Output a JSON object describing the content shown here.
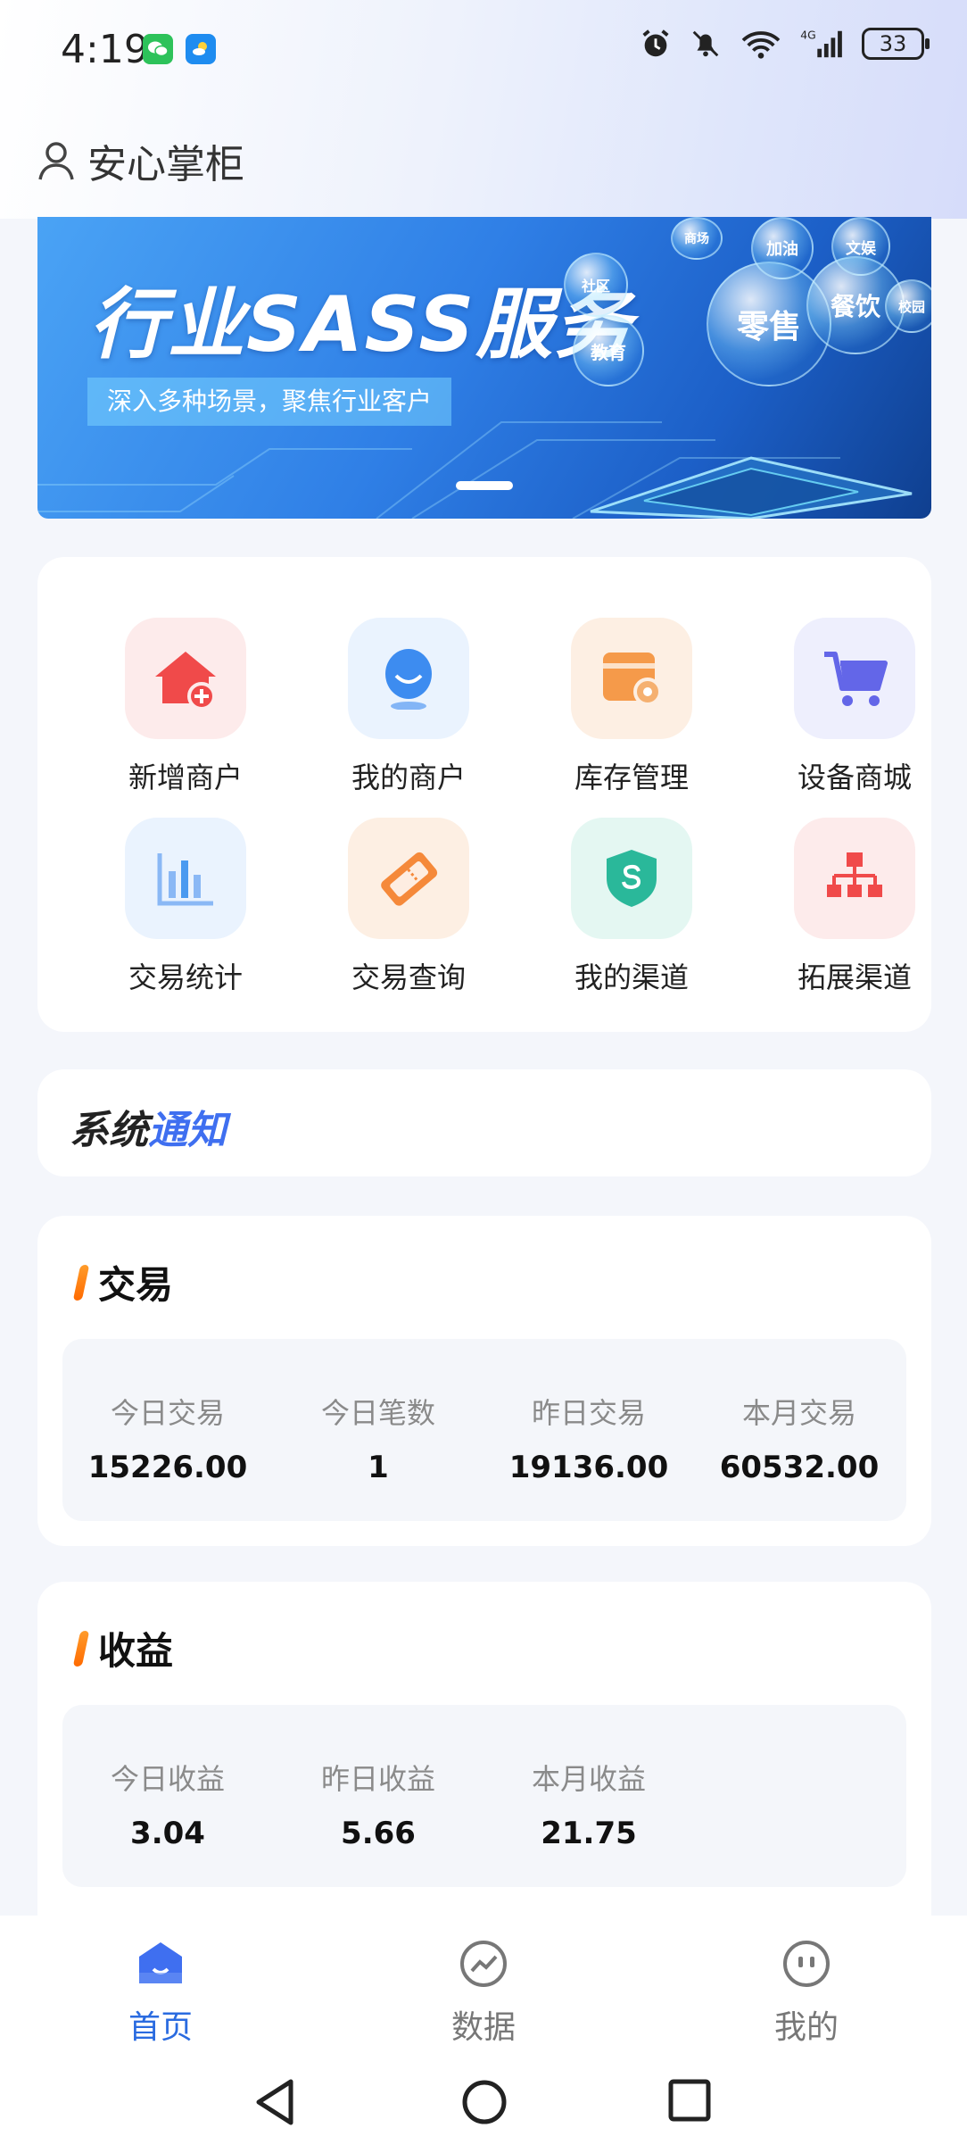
{
  "status_bar": {
    "time": "4:19",
    "battery": "33"
  },
  "header": {
    "title": "安心掌柜"
  },
  "banner": {
    "title": "行业SASS服务",
    "subtitle": "深入多种场景，聚焦行业客户",
    "bubbles": [
      "零售",
      "餐饮",
      "教育",
      "加油",
      "文娱",
      "商场",
      "社区",
      "校园"
    ]
  },
  "menu": [
    {
      "label": "新增商户",
      "icon": "house-add-icon",
      "color": "#f04a4a",
      "bg": "#fdebeb"
    },
    {
      "label": "我的商户",
      "icon": "user-face-icon",
      "color": "#3d8cf0",
      "bg": "#eaf3fe"
    },
    {
      "label": "库存管理",
      "icon": "box-gear-icon",
      "color": "#f59a4a",
      "bg": "#fdefe3"
    },
    {
      "label": "设备商城",
      "icon": "cart-icon",
      "color": "#6366e8",
      "bg": "#eeeffd"
    },
    {
      "label": "交易统计",
      "icon": "bar-chart-icon",
      "color": "#4a9af0",
      "bg": "#eaf3fe"
    },
    {
      "label": "交易查询",
      "icon": "ticket-icon",
      "color": "#f5893a",
      "bg": "#fdefe3"
    },
    {
      "label": "我的渠道",
      "icon": "shield-money-icon",
      "color": "#2ab89a",
      "bg": "#e4f7f2"
    },
    {
      "label": "拓展渠道",
      "icon": "org-chart-icon",
      "color": "#f04a4a",
      "bg": "#fdebeb"
    }
  ],
  "notice": {
    "part1": "系统",
    "part2": "通知"
  },
  "trade": {
    "title": "交易",
    "stats": [
      {
        "label": "今日交易",
        "value": "15226.00"
      },
      {
        "label": "今日笔数",
        "value": "1"
      },
      {
        "label": "昨日交易",
        "value": "19136.00"
      },
      {
        "label": "本月交易",
        "value": "60532.00"
      }
    ]
  },
  "income": {
    "title": "收益",
    "stats": [
      {
        "label": "今日收益",
        "value": "3.04"
      },
      {
        "label": "昨日收益",
        "value": "5.66"
      },
      {
        "label": "本月收益",
        "value": "21.75"
      }
    ]
  },
  "tabs": [
    {
      "label": "首页",
      "icon": "home-icon",
      "active": true
    },
    {
      "label": "数据",
      "icon": "data-chart-icon",
      "active": false
    },
    {
      "label": "我的",
      "icon": "profile-icon",
      "active": false
    }
  ],
  "colors": {
    "accent": "#2a6be0",
    "notice_blue": "#3f6ff0",
    "orange": "#ff7a10"
  }
}
